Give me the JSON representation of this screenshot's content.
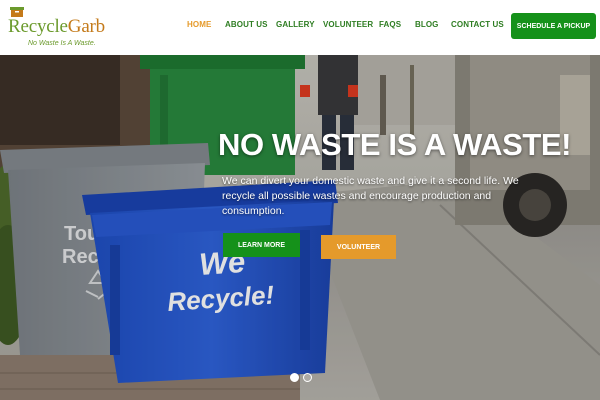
{
  "brand": {
    "name_part1": "Recycle",
    "name_part2": "Garb",
    "tagline": "No Waste Is A Waste."
  },
  "nav": {
    "items": [
      {
        "label": "HOME",
        "active": true
      },
      {
        "label": "ABOUT US",
        "active": false
      },
      {
        "label": "GALLERY",
        "active": false
      },
      {
        "label": "VOLUNTEER",
        "active": false
      },
      {
        "label": "FAQS",
        "active": false
      },
      {
        "label": "BLOG",
        "active": false
      },
      {
        "label": "CONTACT US",
        "active": false
      }
    ],
    "cta_label": "SCHEDULE A PICKUP"
  },
  "hero": {
    "title": "NO WASTE IS A WASTE!",
    "text": "We can divert your domestic waste and give it a second life. We recycle all possible wastes and encourage production and consumption.",
    "primary_button": "LEARN MORE",
    "secondary_button": "VOLUNTEER",
    "bin_text_line1": "We",
    "bin_text_line2": "Recycle!",
    "grey_bin_text_line1": "Tou",
    "grey_bin_text_line2": "Rec",
    "slides_total": 2,
    "slide_active": 1
  },
  "colors": {
    "brand_green": "#15911a",
    "nav_green": "#2e7d22",
    "accent_orange": "#e59a2b",
    "logo_green": "#6b9a2c",
    "logo_orange": "#c47a1a"
  },
  "icons": {
    "logo_mark": "recycle-box-icon",
    "bin_symbol": "recycle-symbol-icon"
  }
}
